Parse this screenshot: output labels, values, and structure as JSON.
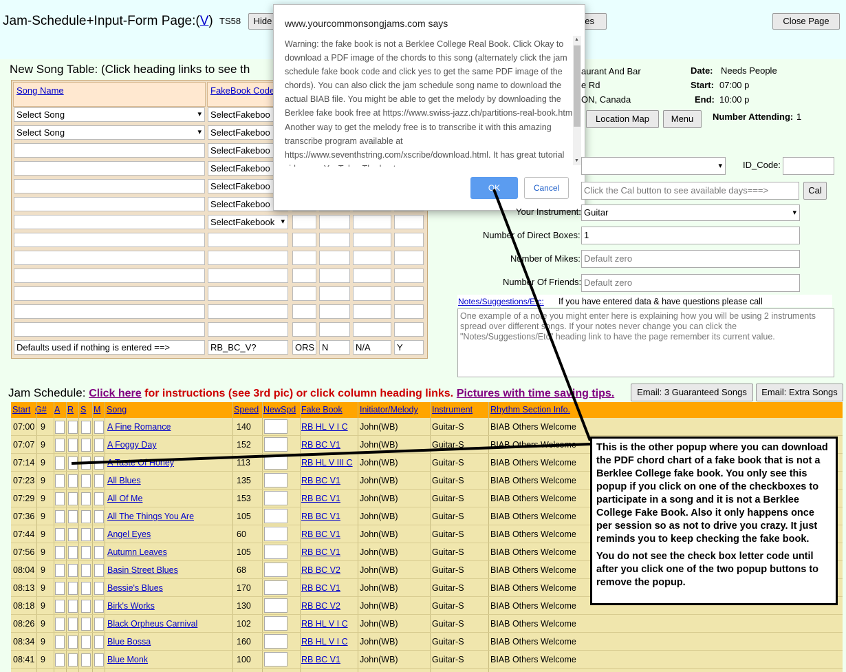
{
  "header": {
    "title": "Jam-Schedule+Input-Form Page:(",
    "title_link": "V",
    "title_end": ")",
    "code": "TS58",
    "hide_button": "Hide",
    "partial_button": "ees",
    "close_button": "Close Page"
  },
  "new_song_table": {
    "title": "New Song Table: (Click heading links to see th",
    "col_song": "Song Name",
    "col_fakebook": "FakeBook Code",
    "select_song": "Select Song",
    "select_fakebook": "SelectFakeboo",
    "select_fakebook_full": "SelectFakebook",
    "defaults_label": "Defaults used if nothing is entered ==>",
    "defaults_fakebook": "RB_BC_V?",
    "defaults_col3": "ORS",
    "defaults_col4": "N",
    "defaults_col5": "N/A",
    "defaults_col6": "Y"
  },
  "popup": {
    "site": "www.yourcommonsongjams.com says",
    "message": "Warning: the fake book is not a Berklee College Real Book. Click Okay to download a PDF image of the chords to this song (alternately click the jam schedule fake book code and click yes to get the same PDF image of the chords). You can also click the jam schedule song name to download the actual BIAB file. You might be able to get the melody by downloading the Berklee fake book free at https://www.swiss-jazz.ch/partitions-real-book.htm   Another way to get the melody free is to transcribe it with this amazing transcribe program available at https://www.seventhstring.com/xscribe/download.html. It has great tutorial videos on YouTube. The best",
    "ok": "OK",
    "cancel": "Cancel"
  },
  "venue": {
    "line1": "aurant And Bar",
    "line2": "e Rd",
    "line3": "ON, Canada",
    "date_label": "Date:",
    "date_value": "Needs People",
    "start_label": "Start:",
    "start_value": "07:00 p",
    "end_label": "End:",
    "end_value": "10:00 p",
    "location_map": "Location Map",
    "menu": "Menu",
    "attending_label": "Number Attending:",
    "attending_value": "1"
  },
  "form": {
    "id_code_label": "ID_Code:",
    "cal_placeholder": "Click the Cal button to see available days===>",
    "cal_button": "Cal",
    "instrument_label": "Your Instrument:",
    "instrument_value": "Guitar",
    "direct_boxes_label": "Number of Direct Boxes:",
    "direct_boxes_value": "1",
    "mikes_label": "Number of Mikes:",
    "mikes_placeholder": "Default zero",
    "friends_label": "Number Of Friends:",
    "friends_placeholder": "Default zero",
    "notes_link": "Notes/Suggestions/Etc:",
    "notes_hint": "If you have entered data & have questions please call",
    "notes_placeholder": "One example of a note you might enter here is explaining how you will be using 2 instruments spread over different songs. If your notes never change you can click the \"Notes/Suggestions/Etc\" heading link to have the page remember its current value."
  },
  "jam_schedule": {
    "title": "Jam Schedule:",
    "click_here": "Click here",
    "instructions": " for instructions (see 3rd pic) or click column heading links.",
    "pictures_link": "Pictures with time saving tips.",
    "email_guaranteed": "Email: 3 Guaranteed Songs",
    "email_extra": "Email: Extra Songs",
    "columns": [
      "Start",
      "G#",
      "A",
      "R",
      "S",
      "M",
      "Song",
      "Speed",
      "NewSpd",
      "Fake Book",
      "Initiator/Melody",
      "Instrument",
      "Rhythm Section Info."
    ],
    "rows": [
      {
        "start": "07:00",
        "g": "9",
        "song": "A Fine Romance",
        "speed": "140",
        "fakebook": "RB HL V I C",
        "initiator": "John(WB)",
        "instrument": "Guitar-S",
        "rhythm": "BIAB Others Welcome"
      },
      {
        "start": "07:07",
        "g": "9",
        "song": "A Foggy Day",
        "speed": "152",
        "fakebook": "RB BC V1",
        "initiator": "John(WB)",
        "instrument": "Guitar-S",
        "rhythm": "BIAB Others Welcome"
      },
      {
        "start": "07:14",
        "g": "9",
        "song": "A Taste Of Honey",
        "speed": "113",
        "fakebook": "RB HL V III C",
        "initiator": "John(WB)",
        "instrument": "Guitar-S",
        "rhythm": "BIAB Others Welcome"
      },
      {
        "start": "07:23",
        "g": "9",
        "song": "All Blues",
        "speed": "135",
        "fakebook": "RB BC V1",
        "initiator": "John(WB)",
        "instrument": "Guitar-S",
        "rhythm": "BIAB Others Welcome"
      },
      {
        "start": "07:29",
        "g": "9",
        "song": "All Of Me",
        "speed": "153",
        "fakebook": "RB BC V1",
        "initiator": "John(WB)",
        "instrument": "Guitar-S",
        "rhythm": "BIAB Others Welcome"
      },
      {
        "start": "07:36",
        "g": "9",
        "song": "All The Things You Are",
        "speed": "105",
        "fakebook": "RB BC V1",
        "initiator": "John(WB)",
        "instrument": "Guitar-S",
        "rhythm": "BIAB Others Welcome"
      },
      {
        "start": "07:44",
        "g": "9",
        "song": "Angel Eyes",
        "speed": "60",
        "fakebook": "RB BC V1",
        "initiator": "John(WB)",
        "instrument": "Guitar-S",
        "rhythm": "BIAB Others Welcome"
      },
      {
        "start": "07:56",
        "g": "9",
        "song": "Autumn Leaves",
        "speed": "105",
        "fakebook": "RB BC V1",
        "initiator": "John(WB)",
        "instrument": "Guitar-S",
        "rhythm": "BIAB Others Welcome"
      },
      {
        "start": "08:04",
        "g": "9",
        "song": "Basin Street Blues",
        "speed": "68",
        "fakebook": "RB BC V2",
        "initiator": "John(WB)",
        "instrument": "Guitar-S",
        "rhythm": "BIAB Others Welcome"
      },
      {
        "start": "08:13",
        "g": "9",
        "song": "Bessie's Blues",
        "speed": "170",
        "fakebook": "RB BC V1",
        "initiator": "John(WB)",
        "instrument": "Guitar-S",
        "rhythm": "BIAB Others Welcome"
      },
      {
        "start": "08:18",
        "g": "9",
        "song": "Birk's Works",
        "speed": "130",
        "fakebook": "RB BC V2",
        "initiator": "John(WB)",
        "instrument": "Guitar-S",
        "rhythm": "BIAB Others Welcome"
      },
      {
        "start": "08:26",
        "g": "9",
        "song": "Black Orpheus Carnival",
        "speed": "102",
        "fakebook": "RB HL V I C",
        "initiator": "John(WB)",
        "instrument": "Guitar-S",
        "rhythm": "BIAB Others Welcome"
      },
      {
        "start": "08:34",
        "g": "9",
        "song": "Blue Bossa",
        "speed": "160",
        "fakebook": "RB HL V I C",
        "initiator": "John(WB)",
        "instrument": "Guitar-S",
        "rhythm": "BIAB Others Welcome"
      },
      {
        "start": "08:41",
        "g": "9",
        "song": "Blue Monk",
        "speed": "100",
        "fakebook": "RB BC V1",
        "initiator": "John(WB)",
        "instrument": "Guitar-S",
        "rhythm": "BIAB Others Welcome"
      }
    ]
  },
  "callout": {
    "para1": "This is the other popup where you can download the PDF chord chart of a fake book that is not a Berklee College fake book. You only see this popup if you click on one of the checkboxes to participate in a song and it is not a Berklee College Fake Book.   Also it only happens once per session so as not to drive you crazy. It just reminds you to keep checking the fake book.",
    "para2": "You do not see the check box letter code until after you click one of the two popup buttons to remove the popup."
  }
}
